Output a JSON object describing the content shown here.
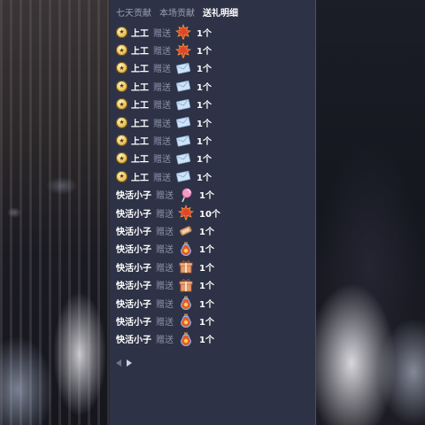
{
  "tabs": [
    "七天贡献",
    "本场贡献",
    "送礼明细"
  ],
  "active_tab": 2,
  "verb": "赠送",
  "rows": [
    {
      "badge": true,
      "user": "上工",
      "gift": "maple-leaf-icon",
      "count": "1个"
    },
    {
      "badge": true,
      "user": "上工",
      "gift": "maple-leaf-icon",
      "count": "1个"
    },
    {
      "badge": true,
      "user": "上工",
      "gift": "envelope-icon",
      "count": "1个"
    },
    {
      "badge": true,
      "user": "上工",
      "gift": "envelope-icon",
      "count": "1个"
    },
    {
      "badge": true,
      "user": "上工",
      "gift": "envelope-icon",
      "count": "1个"
    },
    {
      "badge": true,
      "user": "上工",
      "gift": "envelope-icon",
      "count": "1个"
    },
    {
      "badge": true,
      "user": "上工",
      "gift": "envelope-icon",
      "count": "1个"
    },
    {
      "badge": true,
      "user": "上工",
      "gift": "envelope-icon",
      "count": "1个"
    },
    {
      "badge": true,
      "user": "上工",
      "gift": "envelope-icon",
      "count": "1个"
    },
    {
      "badge": false,
      "user": "快活小子",
      "gift": "lollipop-icon",
      "count": "1个"
    },
    {
      "badge": false,
      "user": "快活小子",
      "gift": "maple-leaf-icon",
      "count": "10个"
    },
    {
      "badge": false,
      "user": "快活小子",
      "gift": "scroll-icon",
      "count": "1个"
    },
    {
      "badge": false,
      "user": "快活小子",
      "gift": "potion-icon",
      "count": "1个"
    },
    {
      "badge": false,
      "user": "快活小子",
      "gift": "gift-box-icon",
      "count": "1个"
    },
    {
      "badge": false,
      "user": "快活小子",
      "gift": "gift-box-icon",
      "count": "1个"
    },
    {
      "badge": false,
      "user": "快活小子",
      "gift": "potion-icon",
      "count": "1个"
    },
    {
      "badge": false,
      "user": "快活小子",
      "gift": "potion-icon",
      "count": "1个"
    },
    {
      "badge": false,
      "user": "快活小子",
      "gift": "potion-icon",
      "count": "1个"
    }
  ],
  "colors": {
    "panel_bg": "#2e3246",
    "tab_inactive": "#9aa0b4",
    "tab_active": "#ffffff",
    "verb": "#8a90a6",
    "text": "#ffffff"
  }
}
